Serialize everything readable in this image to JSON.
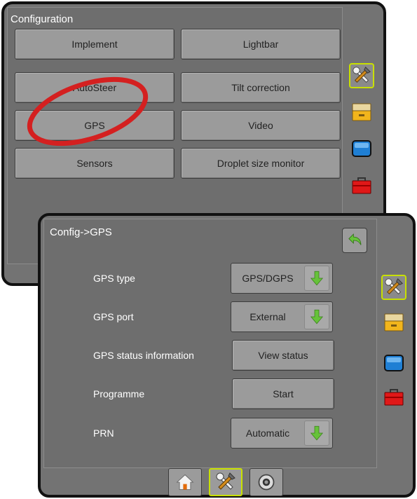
{
  "config_screen": {
    "title": "Configuration",
    "buttons": [
      "Implement",
      "Lightbar",
      "AutoSteer",
      "Tilt correction",
      "GPS",
      "Video",
      "Sensors",
      "Droplet size monitor"
    ]
  },
  "gps_screen": {
    "title": "Config->GPS",
    "rows": [
      {
        "label": "GPS type",
        "value": "GPS/DGPS"
      },
      {
        "label": "GPS port",
        "value": "External"
      },
      {
        "label": "GPS status information",
        "value": "View status"
      },
      {
        "label": "Programme",
        "value": "Start"
      },
      {
        "label": "PRN",
        "value": "Automatic"
      }
    ]
  },
  "colors": {
    "highlight_circle": "#d42020",
    "active_outline": "#c8e000",
    "panel_bg": "#737373",
    "button_bg": "#9b9b9b",
    "dropdown_arrow": "#66c23a"
  },
  "icons": {
    "side_tabs": [
      "tools-icon",
      "storage-drawer-icon",
      "display-icon",
      "toolbox-icon"
    ],
    "bottom_nav": [
      "home-icon",
      "tools-icon",
      "camera-icon"
    ],
    "back": "back-arrow-icon",
    "dropdown": "down-arrow-icon"
  }
}
